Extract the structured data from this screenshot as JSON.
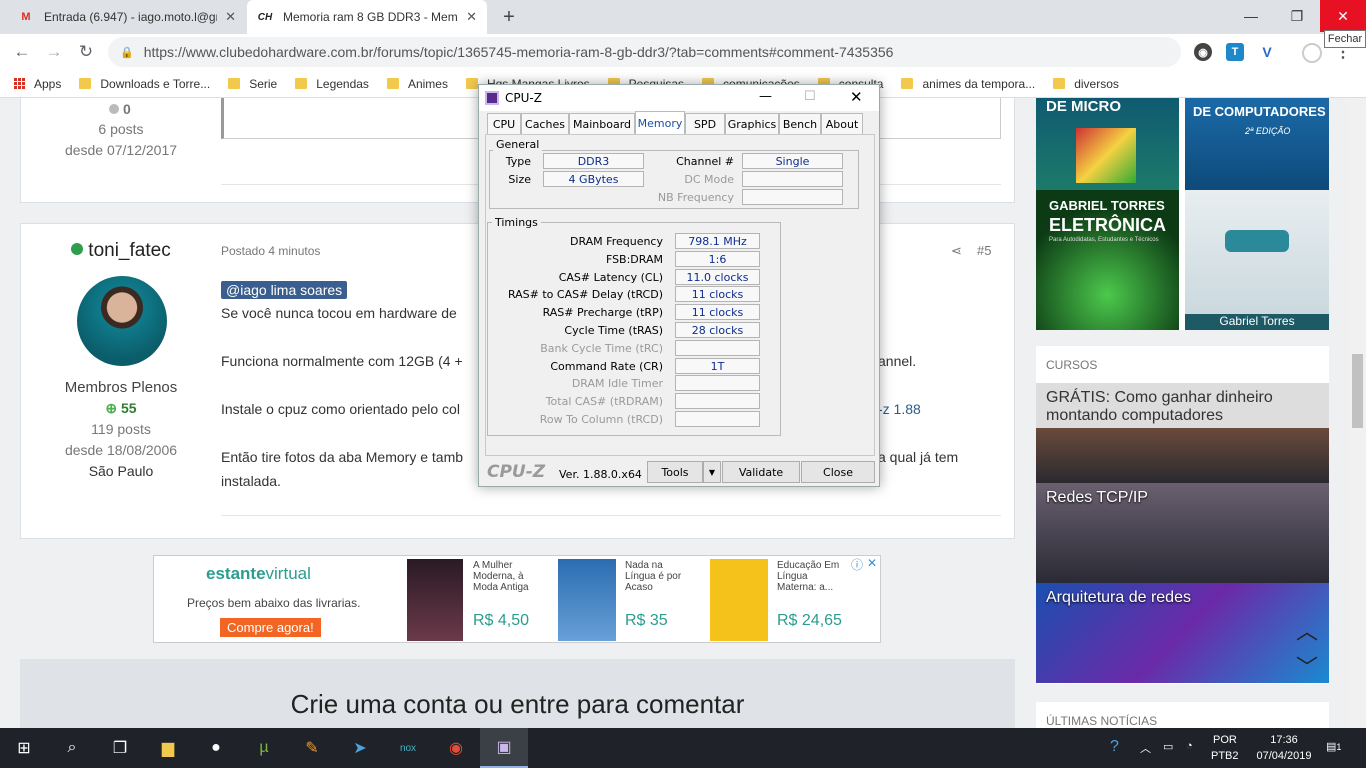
{
  "browser": {
    "tabs": [
      {
        "title": "Entrada (6.947) - iago.moto.l@gm",
        "favicon": "gmail-icon"
      },
      {
        "title": "Memoria ram 8 GB DDR3 - Mem",
        "favicon": "clubedohardware-icon"
      }
    ],
    "new_tab": "+",
    "minimize": "—",
    "restore": "❐",
    "close": "✕",
    "close_tooltip": "Fechar",
    "url": "https://www.clubedohardware.com.br/forums/topic/1365745-memoria-ram-8-gb-ddr3/?tab=comments#comment-7435356",
    "bookmarks": [
      "Apps",
      "Downloads e Torre...",
      "Serie",
      "Legendas",
      "Animes",
      "Hqs Mangas Livros",
      "Pesquisas",
      "comunicações",
      "consulta",
      "animes da tempora...",
      "diversos"
    ]
  },
  "forum": {
    "prev_post": {
      "reputation": "0",
      "posts": "6 posts",
      "since": "desde 07/12/2017"
    },
    "post": {
      "author": "toni_fatec",
      "group": "Membros Plenos",
      "reputation": "55",
      "posts": "119 posts",
      "since": "desde 18/08/2006",
      "location": "São Paulo",
      "posted": "Postado 4 minutos",
      "number": "#5",
      "mention": "@iago lima soares",
      "p1": "Se você nunca tocou em hardware de",
      "p2a": "Funciona normalmente com 12GB (4 +",
      "p2b": "annel.",
      "p3a": "Instale o cpuz como orientado pelo col",
      "p3b": "-z 1.88",
      "p4a": "Então tire fotos da aba Memory e tamb",
      "p4b": "a qual já tem",
      "p4c": "instalada."
    },
    "ad": {
      "brand_a": "estante",
      "brand_b": "virtual",
      "tagline": "Preços bem abaixo das livrarias.",
      "cta": "Compre agora!",
      "books": [
        {
          "title": "A Mulher Moderna, à Moda Antiga",
          "price": "R$ 4,50"
        },
        {
          "title": "Nada na Língua é por Acaso",
          "price": "R$ 35"
        },
        {
          "title": "Educação Em Língua Materna: a...",
          "price": "R$ 24,65"
        }
      ]
    },
    "create_account": "Crie uma conta ou entre para comentar"
  },
  "sidebar": {
    "covers": [
      {
        "label": "DE MICRO"
      },
      {
        "label": "DE COMPUTADORES",
        "sub": "2ª EDIÇÃO"
      },
      {
        "label": "GABRIEL TORRES",
        "big": "ELETRÔNICA",
        "sub": "Para Autodidatas, Estudantes e Técnicos"
      },
      {
        "label": "Gabriel Torres"
      }
    ],
    "courses_title": "CURSOS",
    "courses": [
      "GRÁTIS: Como ganhar dinheiro montando computadores",
      "Redes TCP/IP",
      "Arquitetura de redes"
    ],
    "news_title": "ÚLTIMAS NOTÍCIAS"
  },
  "cpuz": {
    "title": "CPU-Z",
    "tabs": [
      "CPU",
      "Caches",
      "Mainboard",
      "Memory",
      "SPD",
      "Graphics",
      "Bench",
      "About"
    ],
    "general_title": "General",
    "general": {
      "type_label": "Type",
      "type": "DDR3",
      "size_label": "Size",
      "size": "4 GBytes",
      "channel_label": "Channel #",
      "channel": "Single",
      "dc_label": "DC Mode",
      "nb_label": "NB Frequency"
    },
    "timings_title": "Timings",
    "timings": [
      {
        "label": "DRAM Frequency",
        "value": "798.1 MHz",
        "enabled": true
      },
      {
        "label": "FSB:DRAM",
        "value": "1:6",
        "enabled": true
      },
      {
        "label": "CAS# Latency (CL)",
        "value": "11.0 clocks",
        "enabled": true
      },
      {
        "label": "RAS# to CAS# Delay (tRCD)",
        "value": "11 clocks",
        "enabled": true
      },
      {
        "label": "RAS# Precharge (tRP)",
        "value": "11 clocks",
        "enabled": true
      },
      {
        "label": "Cycle Time (tRAS)",
        "value": "28 clocks",
        "enabled": true
      },
      {
        "label": "Bank Cycle Time (tRC)",
        "value": "",
        "enabled": false
      },
      {
        "label": "Command Rate (CR)",
        "value": "1T",
        "enabled": true
      },
      {
        "label": "DRAM Idle Timer",
        "value": "",
        "enabled": false
      },
      {
        "label": "Total CAS# (tRDRAM)",
        "value": "",
        "enabled": false
      },
      {
        "label": "Row To Column (tRCD)",
        "value": "",
        "enabled": false
      }
    ],
    "logo": "CPU-Z",
    "version": "Ver. 1.88.0.x64",
    "tools": "Tools",
    "validate": "Validate",
    "close": "Close"
  },
  "taskbar": {
    "lang1": "POR",
    "lang2": "PTB2",
    "time": "17:36",
    "date": "07/04/2019",
    "notif": "1"
  }
}
